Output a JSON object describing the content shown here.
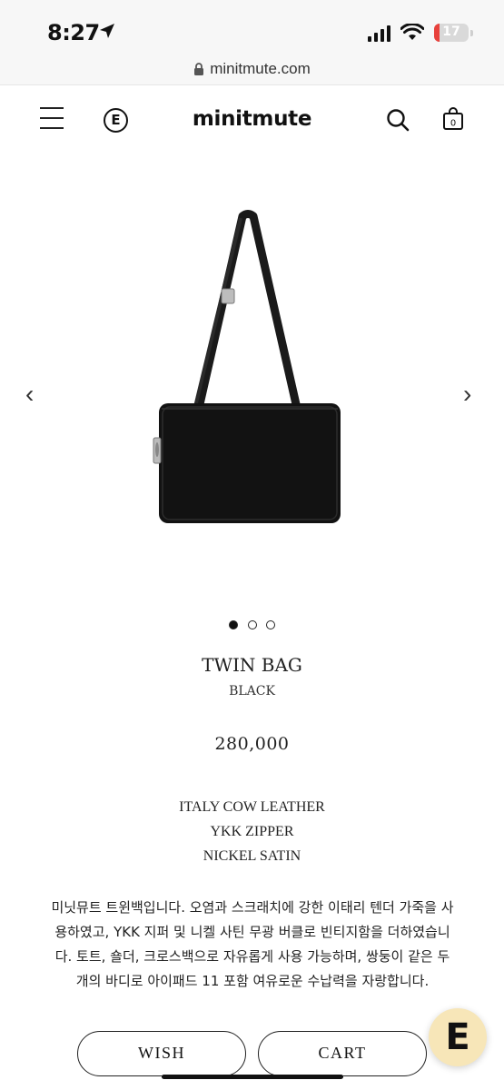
{
  "status_bar": {
    "time": "8:27",
    "battery_level": "17",
    "battery_fraction": 0.17,
    "icons": [
      "location-arrow-icon",
      "signal-icon",
      "wifi-icon",
      "battery-icon"
    ]
  },
  "url_bar": {
    "url": "minitmute.com",
    "icon": "lock-icon"
  },
  "header": {
    "brand": "minitmute",
    "e_logo": "E",
    "icons": [
      "menu-icon",
      "e-logo-icon",
      "search-icon",
      "shopping-bag-icon"
    ],
    "bag_count": "0"
  },
  "gallery": {
    "prev_icon": "chevron-left-icon",
    "next_icon": "chevron-right-icon",
    "prev": "‹",
    "next": "›",
    "total_images": 3,
    "current_index": 1
  },
  "product": {
    "name": "TWIN BAG",
    "color": "BLACK",
    "price": "280,000",
    "specs": [
      "ITALY COW LEATHER",
      "YKK ZIPPER",
      "NICKEL SATIN"
    ],
    "description_lines": [
      "미닛뮤트 트윈백입니다. 오염과 스크래치에 강한 이태리 텐더 가죽을 사",
      "용하였고, YKK 지퍼 및 니켈 사틴 무광 버클로 빈티지함을 더하였습니",
      "다. 토트, 숄더, 크로스백으로 자유롭게 사용 가능하며, 쌍둥이 같은 두",
      "개의 바디로 아이패드 11 포함 여유로운 수납력을 자랑합니다."
    ]
  },
  "actions": {
    "wish_label": "WISH",
    "cart_label": "CART"
  },
  "fab": {
    "label": "E",
    "icon": "e-chat-icon"
  },
  "colors": {
    "accent": "#111111",
    "fab_bg": "#f7e6b8",
    "battery_red": "#e8413c"
  }
}
